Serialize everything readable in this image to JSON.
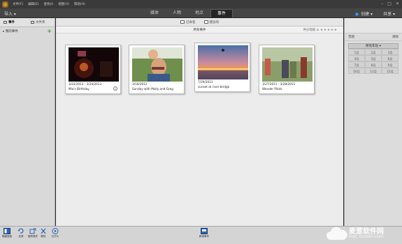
{
  "menu": [
    "文件(F)",
    "编辑(E)",
    "查找(I)",
    "视图(V)",
    "帮助(H)"
  ],
  "toolbar": {
    "import_label": "导入 ▾",
    "create_label": "创建 ▾",
    "share_label": "共享 ▾"
  },
  "tabs": [
    "媒体",
    "人物",
    "地点",
    "事件"
  ],
  "active_tab": "事件",
  "left_panel": {
    "tab_events": "事件",
    "tab_folders": "文件夹",
    "my_events": "▸ 我的事件"
  },
  "main": {
    "top_actions": [
      "已命名",
      "建议的"
    ],
    "header": "所有事件",
    "rating_label": "评分等级 ≥",
    "rating_stars": "★★★★★"
  },
  "events": [
    {
      "date": "3/22/2013 - 3/24/2013",
      "name": "Mia's Birthday",
      "has_info": true
    },
    {
      "date": "3/10/2012",
      "name": "Sunday with Molly and Greg",
      "has_info": false
    },
    {
      "date": "7/29/2011",
      "name": "sunset at river bridge",
      "has_info": false
    },
    {
      "date": "3/27/2011 - 3/28/2011",
      "name": "Wonder Pilots",
      "has_info": false
    }
  ],
  "right_panel": {
    "range_label": "范围",
    "clear_label": "清除",
    "year_label": "所有年份 ▾",
    "months": [
      "1月",
      "2月",
      "3月",
      "4月",
      "5月",
      "6月",
      "7月",
      "8月",
      "9月",
      "10月",
      "11月",
      "12月"
    ]
  },
  "bottom": {
    "left_buttons": [
      "隐藏面板",
      "还原",
      "旋转操作",
      "删除",
      "幻灯片"
    ],
    "center_button": "新增事件"
  },
  "watermark": {
    "text": "麦葱软件网",
    "sub": "mac.orsoon.com"
  },
  "colors": {
    "accent": "#3d8ef0",
    "add": "#3aa33a",
    "panel_bg": "#d9d9d9",
    "bar_bg": "#454545"
  }
}
